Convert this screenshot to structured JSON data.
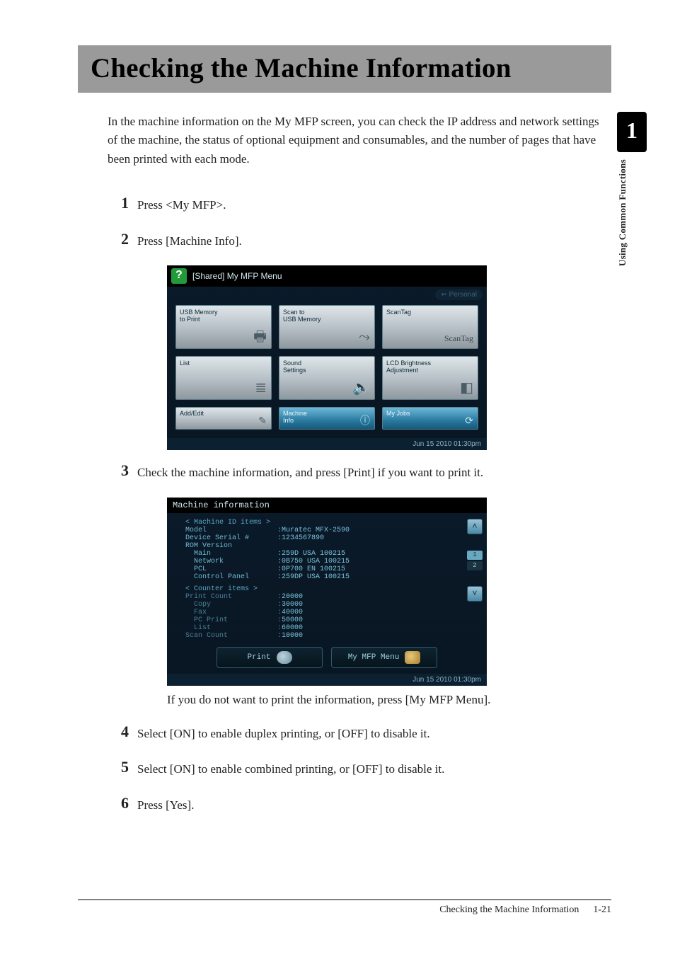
{
  "sidebar": {
    "chapter_number": "1",
    "chapter_label": "Using Common Functions"
  },
  "title": "Checking the Machine Information",
  "intro": "In the machine information on the My MFP screen, you can check the IP address and network settings of the machine, the status of optional equipment and consumables, and the number of pages that have been printed with each mode.",
  "steps": {
    "s1": "Press <My MFP>.",
    "s2": "Press [Machine Info].",
    "s3": "Check the machine information, and press [Print] if you want to print it.",
    "s3_sub": "If you do not want to print the information, press [My MFP Menu].",
    "s4": "Select [ON] to enable duplex printing, or [OFF] to disable it.",
    "s5": "Select [ON] to enable combined printing, or [OFF] to disable it.",
    "s6": "Press [Yes]."
  },
  "shot1": {
    "header": "[Shared] My MFP Menu",
    "personal": "⇐ Personal",
    "tiles": {
      "usb_to_print": "USB Memory\nto Print",
      "scan_to_usb": "Scan to\nUSB Memory",
      "scantag": "ScanTag",
      "scantag_logo": "ScanTag",
      "list": "List",
      "sound": "Sound\nSettings",
      "lcd": "LCD Brightness\nAdjustment",
      "add_edit": "Add/Edit",
      "machine_info": "Machine\nInfo",
      "my_jobs": "My Jobs"
    },
    "footer": "Jun 15 2010 01:30pm"
  },
  "shot2": {
    "header": "Machine information",
    "section_id": "< Machine ID items >",
    "rows_id": [
      {
        "l": "Model",
        "v": "Muratec MFX-2590"
      },
      {
        "l": "Device Serial #",
        "v": "1234567890"
      },
      {
        "l": "ROM Version",
        "v": ""
      },
      {
        "l": "  Main",
        "v": "259D  USA 100215"
      },
      {
        "l": "  Network",
        "v": "0B750 USA 100215"
      },
      {
        "l": "  PCL",
        "v": "0P700 EN  100215"
      },
      {
        "l": "  Control Panel",
        "v": "259DP USA 100215"
      }
    ],
    "section_counter": "< Counter items >",
    "rows_counter": [
      {
        "l": "Print Count",
        "v": "20000"
      },
      {
        "l": "  Copy",
        "v": "30000"
      },
      {
        "l": "  Fax",
        "v": "40000"
      },
      {
        "l": "  PC Print",
        "v": "50000"
      },
      {
        "l": "  List",
        "v": "60000"
      },
      {
        "l": "Scan Count",
        "v": "10000"
      }
    ],
    "scroll": {
      "page_active": "1",
      "page_total": "2"
    },
    "buttons": {
      "print": "Print",
      "menu": "My MFP Menu"
    },
    "footer": "Jun 15 2010 01:30pm"
  },
  "footer": {
    "title": "Checking the Machine Information",
    "page": "1-21"
  }
}
